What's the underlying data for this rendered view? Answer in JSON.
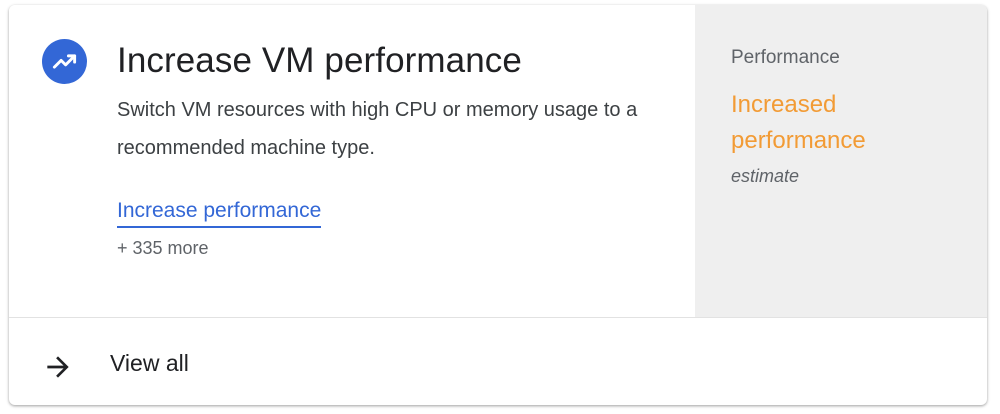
{
  "card": {
    "title": "Increase VM performance",
    "description": "Switch VM resources with high CPU or memory usage to a recommended machine type.",
    "action_link": "Increase performance",
    "more_count": "+ 335 more",
    "icon": "trending-up-icon"
  },
  "side_panel": {
    "label": "Performance",
    "value": "Increased performance",
    "sub": "estimate"
  },
  "footer": {
    "label": "View all",
    "icon": "arrow-right-icon"
  },
  "colors": {
    "accent_blue": "#3367d6",
    "impact_orange": "#f29b35",
    "side_background": "#efefef"
  }
}
